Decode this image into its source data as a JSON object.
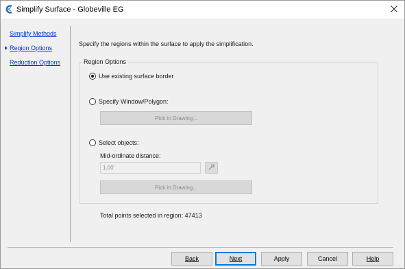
{
  "window": {
    "title": "Simplify Surface - Globeville EG",
    "app_icon": "civil3d-app-icon",
    "close_icon": "close-icon"
  },
  "nav": {
    "items": [
      {
        "label": "Simplify Methods",
        "active": false
      },
      {
        "label": "Region Options",
        "active": true
      },
      {
        "label": "Reduction Options",
        "active": false
      }
    ]
  },
  "main": {
    "instruction": "Specify the regions within the surface to apply the simplification.",
    "group_title": "Region Options",
    "options": [
      {
        "label": "Use existing surface border",
        "selected": true
      },
      {
        "label": "Specify Window/Polygon:",
        "selected": false
      },
      {
        "label": "Select objects:",
        "selected": false
      }
    ],
    "pick_in_drawing_1": "Pick in Drawing...",
    "mid_ordinate_label": "Mid-ordinate distance:",
    "mid_ordinate_value": "1.00'",
    "pick_point_icon": "pick-point-icon",
    "pick_in_drawing_2": "Pick in Drawing...",
    "total_points": "Total points selected in region: 47413"
  },
  "footer": {
    "back": "Back",
    "next": "Next",
    "apply": "Apply",
    "cancel": "Cancel",
    "help": "Help"
  },
  "colors": {
    "link": "#0033cc",
    "default_button_border": "#0078d7",
    "disabled_button": "#d8d8d8"
  }
}
